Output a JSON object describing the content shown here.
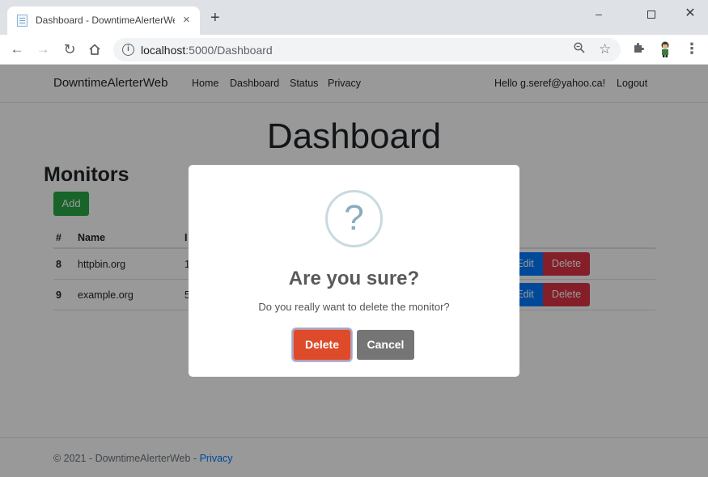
{
  "browser": {
    "tab_title": "Dashboard - DowntimeAlerterWeb",
    "tab_close": "×",
    "new_tab": "+",
    "url_host": "localhost",
    "url_path": ":5000/Dashboard",
    "window_min": "–",
    "window_close": "✕",
    "menu": "⋮"
  },
  "navbar": {
    "brand": "DowntimeAlerterWeb",
    "links": [
      "Home",
      "Dashboard",
      "Status",
      "Privacy"
    ],
    "greeting": "Hello g.seref@yahoo.ca!",
    "logout": "Logout"
  },
  "main": {
    "title": "Dashboard",
    "section_heading": "Monitors",
    "add_label": "Add",
    "table": {
      "headers": [
        "#",
        "Name",
        "I"
      ],
      "rows": [
        {
          "id": "8",
          "name": "httpbin.org",
          "url_fragment": "1",
          "edit": "Edit",
          "delete": "Delete"
        },
        {
          "id": "9",
          "name": "example.org",
          "url_fragment": "5",
          "edit": "Edit",
          "delete": "Delete"
        }
      ]
    }
  },
  "footer": {
    "text": "© 2021 - DowntimeAlerterWeb - ",
    "link": "Privacy"
  },
  "modal": {
    "icon_glyph": "?",
    "title": "Are you sure?",
    "message": "Do you really want to delete the monitor?",
    "confirm_label": "Delete",
    "cancel_label": "Cancel"
  },
  "colors": {
    "add_button": "#28a745",
    "edit_button": "#007bff",
    "delete_button": "#dc3545",
    "modal_confirm": "#dd4b2b",
    "modal_cancel": "#757575"
  }
}
